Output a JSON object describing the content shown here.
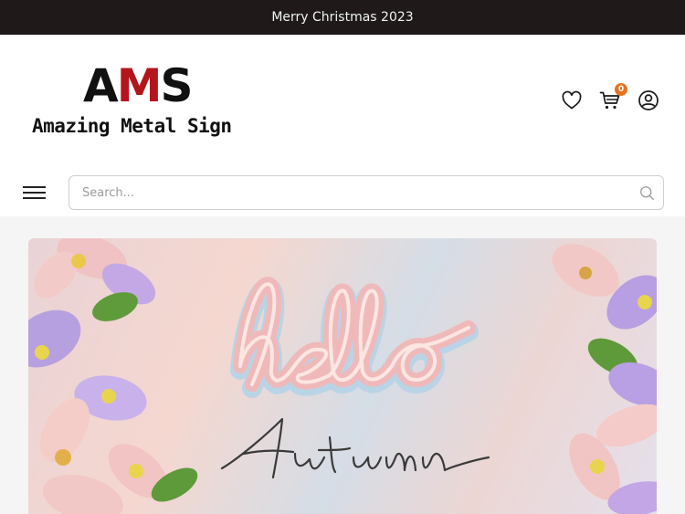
{
  "announcement": {
    "text": "Merry Christmas 2023"
  },
  "brand": {
    "mark_a": "A",
    "mark_m": "M",
    "mark_s": "S",
    "name": "Amazing Metal Sign",
    "mark_color": "#b4141b"
  },
  "header_icons": {
    "wishlist": "heart-icon",
    "cart": "cart-icon",
    "account": "user-icon",
    "cart_count": "0",
    "badge_color": "#e8731f"
  },
  "search": {
    "placeholder": "Search..."
  },
  "banner": {
    "image_alt": "hello Autumn",
    "headline": "hello",
    "subline": "Autumn"
  },
  "colors": {
    "announcement_bg": "#1f1a19",
    "page_bg": "#f5f5f5"
  }
}
